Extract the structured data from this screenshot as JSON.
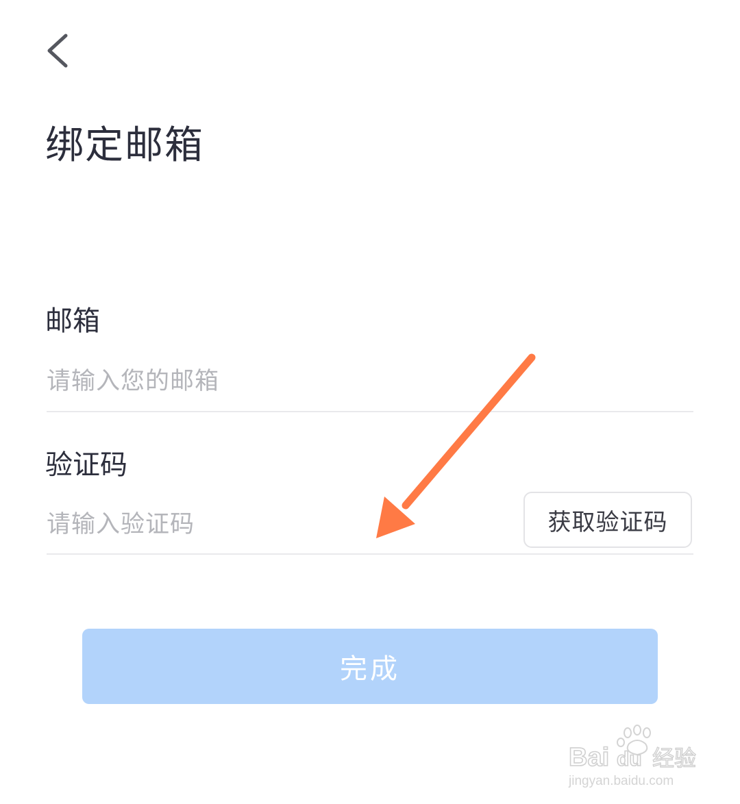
{
  "header": {
    "back_icon": "chevron-left-icon",
    "title": "绑定邮箱"
  },
  "form": {
    "email": {
      "label": "邮箱",
      "placeholder": "请输入您的邮箱",
      "value": ""
    },
    "code": {
      "label": "验证码",
      "placeholder": "请输入验证码",
      "value": "",
      "get_code_label": "获取验证码"
    }
  },
  "actions": {
    "done_label": "完成"
  },
  "annotation": {
    "icon": "arrow-annotation-icon",
    "color": "#ff7a45"
  },
  "watermark": {
    "brand": "Bai du 经验",
    "url": "jingyan.baidu.com"
  },
  "colors": {
    "primary_disabled": "#b2d3fb",
    "text_primary": "#2c2e3c",
    "placeholder": "#b4b5ba",
    "divider": "#e9e9ec"
  }
}
